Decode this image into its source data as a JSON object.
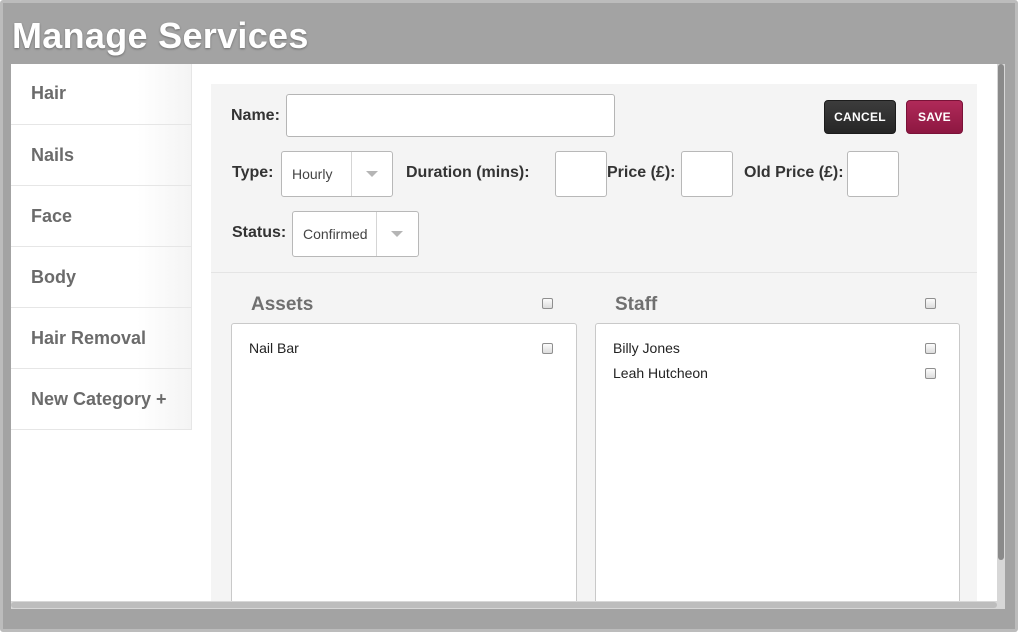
{
  "page": {
    "title": "Manage Services"
  },
  "sidebar": {
    "items": [
      {
        "label": "Hair"
      },
      {
        "label": "Nails"
      },
      {
        "label": "Face"
      },
      {
        "label": "Body"
      },
      {
        "label": "Hair Removal"
      },
      {
        "label": "New Category +"
      }
    ]
  },
  "form": {
    "name_label": "Name:",
    "name_value": "",
    "cancel_label": "CANCEL",
    "save_label": "SAVE",
    "type_label": "Type:",
    "type_value": "Hourly",
    "duration_label": "Duration (mins):",
    "duration_value": "",
    "price_label": "Price (£):",
    "price_value": "",
    "old_price_label": "Old Price (£):",
    "old_price_value": "",
    "status_label": "Status:",
    "status_value": "Confirmed"
  },
  "assets": {
    "title": "Assets",
    "items": [
      {
        "label": "Nail Bar",
        "checked": false
      }
    ]
  },
  "staff": {
    "title": "Staff",
    "items": [
      {
        "label": "Billy Jones",
        "checked": false
      },
      {
        "label": "Leah Hutcheon",
        "checked": false
      }
    ]
  },
  "colors": {
    "backdrop": "#a3a3a3",
    "panel": "#f4f4f4",
    "save_button": "#9c1f4c",
    "cancel_button": "#2f2f2f"
  }
}
